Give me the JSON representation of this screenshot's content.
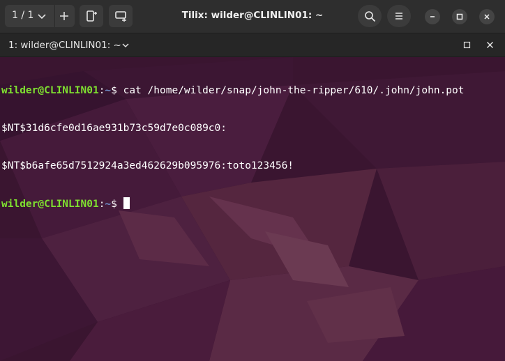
{
  "header": {
    "session_count": "1 / 1",
    "title": "Tilix: wilder@CLINLIN01: ~"
  },
  "terminal_tab": {
    "label": "1: wilder@CLINLIN01: ~"
  },
  "terminal": {
    "prompt_user": "wilder@CLINLIN01",
    "prompt_sep": ":",
    "prompt_path": "~",
    "prompt_symbol": "$",
    "command": " cat /home/wilder/snap/john-the-ripper/610/.john/john.pot",
    "output": [
      "$NT$31d6cfe0d16ae931b73c59d7e0c089c0:",
      "$NT$b6afe65d7512924a3ed462629b095976:toto123456!"
    ]
  },
  "colors": {
    "terminal_bg": "#3a1530",
    "prompt_user": "#7fe030",
    "prompt_path": "#6f8fcc",
    "headerbar": "#2e2e2e"
  },
  "icons": {
    "session_switcher_dropdown": "chevron-down-icon",
    "new_session": "plus-icon",
    "add_terminal_right": "add-terminal-right-icon",
    "add_terminal_down": "add-terminal-down-icon",
    "search": "search-icon",
    "menu": "hamburger-menu-icon",
    "minimize": "minimize-icon",
    "maximize": "maximize-icon",
    "close": "close-icon"
  }
}
